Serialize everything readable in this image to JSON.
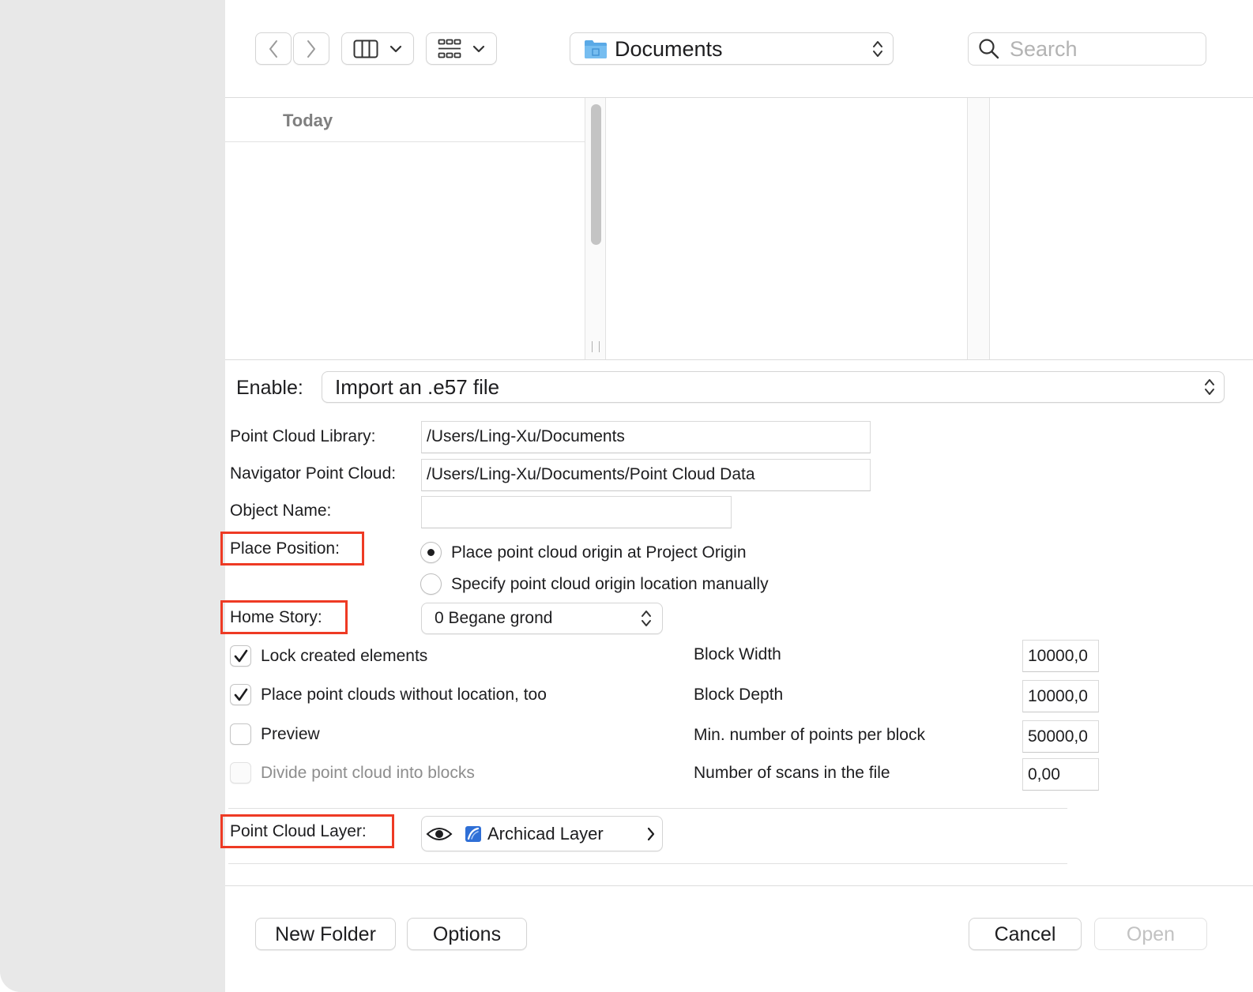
{
  "toolbar": {
    "location": "Documents",
    "search_placeholder": "Search"
  },
  "browser": {
    "section_header": "Today"
  },
  "form": {
    "enable_label": "Enable:",
    "enable_value": "Import an .e57 file",
    "library_label": "Point Cloud Library:",
    "library_value": "/Users/Ling-Xu/Documents",
    "navigator_label": "Navigator Point Cloud:",
    "navigator_value": "/Users/Ling-Xu/Documents/Point Cloud Data",
    "object_name_label": "Object Name:",
    "object_name_value": "",
    "place_position_label": "Place Position:",
    "place_options": [
      {
        "label": "Place point cloud origin at Project Origin",
        "selected": true
      },
      {
        "label": "Specify point cloud origin location manually",
        "selected": false
      }
    ],
    "home_story_label": "Home Story:",
    "home_story_value": "0 Begane grond",
    "checkboxes": [
      {
        "label": "Lock created elements",
        "checked": true,
        "enabled": true
      },
      {
        "label": "Place point clouds without location, too",
        "checked": true,
        "enabled": true
      },
      {
        "label": "Preview",
        "checked": false,
        "enabled": true
      },
      {
        "label": "Divide point cloud into blocks",
        "checked": false,
        "enabled": false
      }
    ],
    "block_fields": [
      {
        "label": "Block Width",
        "value": "10000,0"
      },
      {
        "label": "Block Depth",
        "value": "10000,0"
      },
      {
        "label": "Min. number of points per block",
        "value": "50000,0"
      },
      {
        "label": "Number of scans in the file",
        "value": "0,00"
      }
    ],
    "layer_label": "Point Cloud Layer:",
    "layer_value": "Archicad Layer"
  },
  "footer": {
    "new_folder": "New Folder",
    "options": "Options",
    "cancel": "Cancel",
    "open": "Open"
  },
  "colors": {
    "highlight_box": "#ee3a24",
    "folder_blue": "#5aa9e6"
  }
}
